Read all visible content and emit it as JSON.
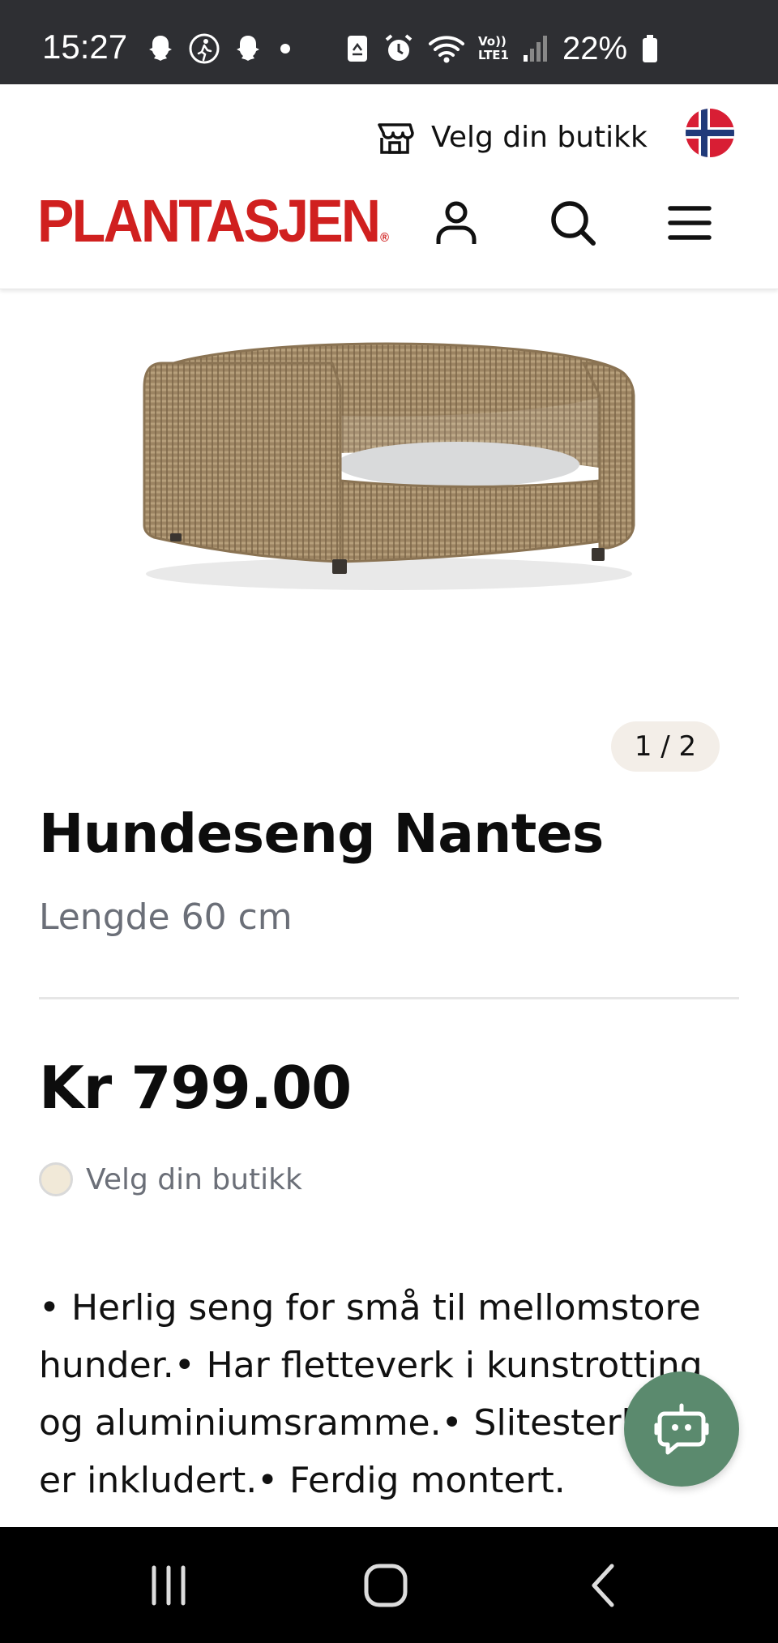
{
  "status_bar": {
    "time": "15:27",
    "battery": "22%",
    "icons": [
      "snapchat-icon",
      "walking-icon",
      "snapchat-icon",
      "dot-icon",
      "recycle-icon",
      "alarm-icon",
      "wifi-icon",
      "volte-icon",
      "signal-icon",
      "battery-icon"
    ],
    "volte_label_top": "Vo))",
    "volte_label_bottom": "LTE1"
  },
  "header": {
    "store_link": "Velg din butikk",
    "logo": "PLANTASJEN",
    "logo_mark": "®",
    "icons": [
      "store-icon",
      "norway-flag-icon",
      "user-icon",
      "search-icon",
      "menu-icon"
    ]
  },
  "product": {
    "image_counter": "1 / 2",
    "title": "Hundeseng Nantes",
    "subtitle": "Lengde 60 cm",
    "price": "Kr 799.00",
    "store_select": "Velg din butikk",
    "description": "• Herlig seng for små til mellomstore hunder.• Har fletteverk i kunstrotting og aluminiumsramme.• Slitesterk pute er inkludert.• Ferdig montert."
  },
  "chat": {
    "icon": "chatbot-icon"
  },
  "nav": {
    "icons": [
      "recents-icon",
      "home-icon",
      "back-icon"
    ]
  },
  "colors": {
    "brand_red": "#d0201f",
    "chat_green": "#5b8a6e",
    "muted_text": "#6b6f78",
    "status_bar": "#2e2f33"
  }
}
